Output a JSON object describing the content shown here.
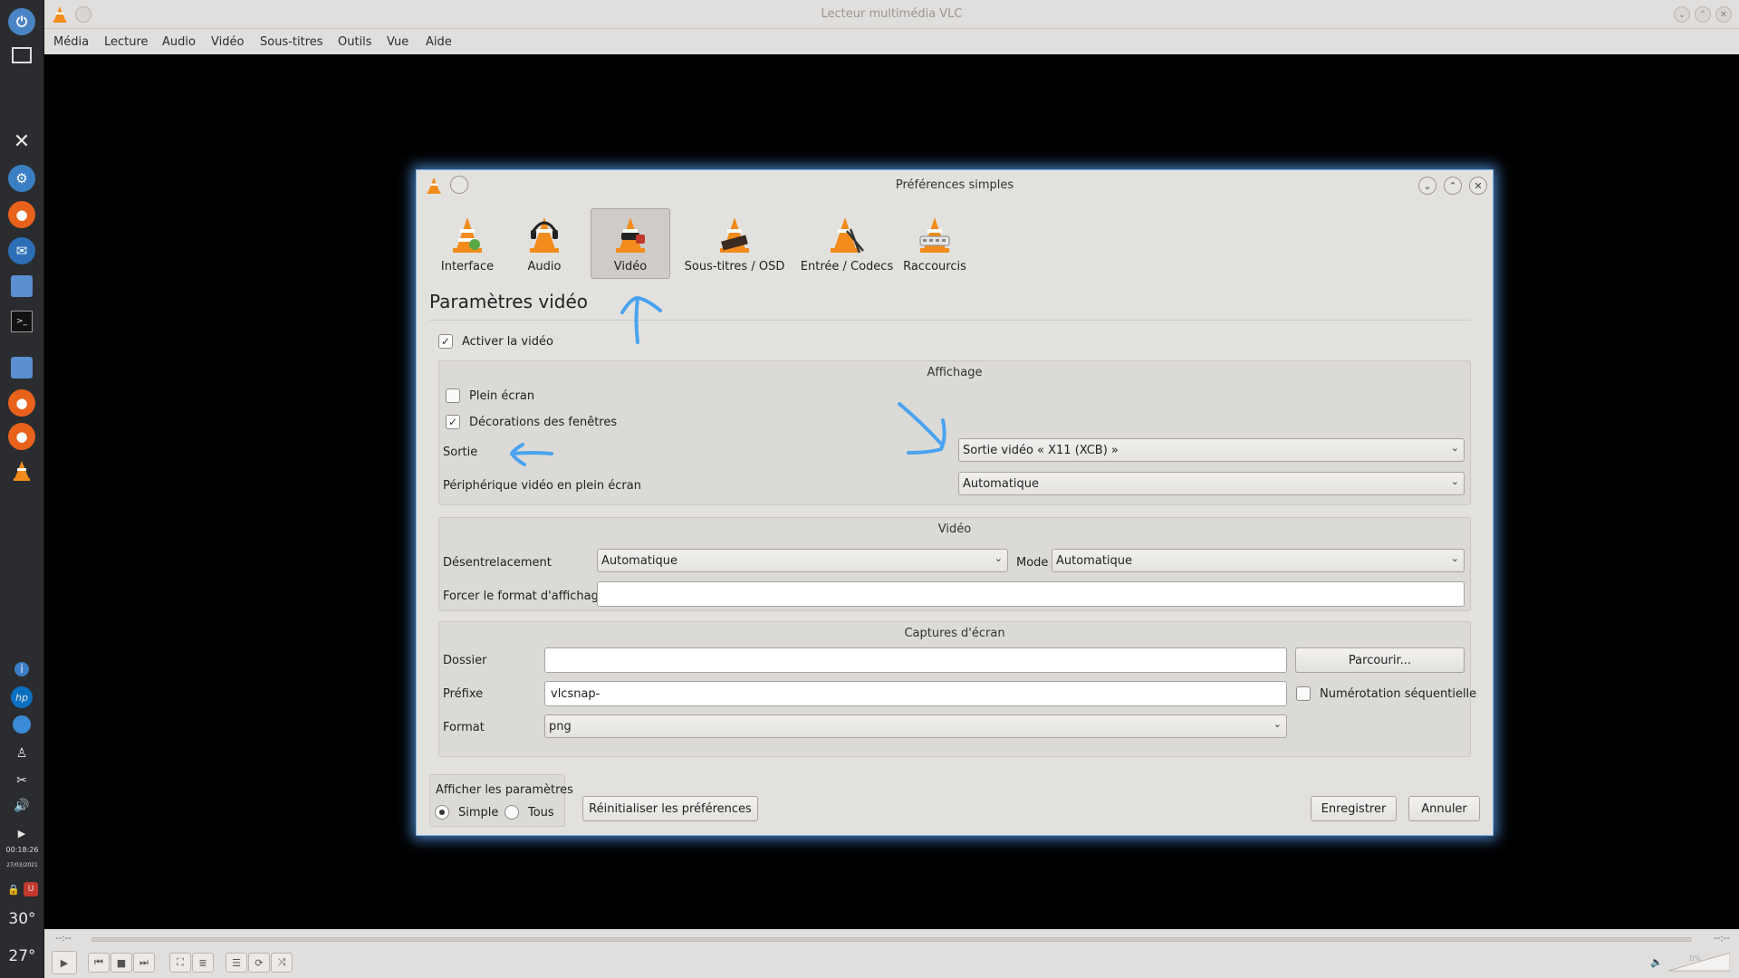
{
  "taskbar": {
    "clock_time": "00:18:26",
    "clock_date": "27/03/2021",
    "temp_1": "30°",
    "temp_2": "27°"
  },
  "vlc": {
    "title": "Lecteur multimédia VLC",
    "menu": [
      "Média",
      "Lecture",
      "Audio",
      "Vidéo",
      "Sous-titres",
      "Outils",
      "Vue",
      "Aide"
    ],
    "time_elapsed": "--:--",
    "time_total": "--:--",
    "volume": "0%"
  },
  "dialog": {
    "title": "Préférences simples",
    "tabs": [
      {
        "label": "Interface",
        "icon": "interface-cone-icon"
      },
      {
        "label": "Audio",
        "icon": "audio-cone-icon"
      },
      {
        "label": "Vidéo",
        "icon": "video-cone-icon"
      },
      {
        "label": "Sous-titres / OSD",
        "icon": "subtitles-cone-icon"
      },
      {
        "label": "Entrée / Codecs",
        "icon": "codecs-cone-icon"
      },
      {
        "label": "Raccourcis",
        "icon": "hotkeys-cone-icon"
      }
    ],
    "active_tab": "Vidéo",
    "section_title": "Paramètres vidéo",
    "enable_video": {
      "label": "Activer la vidéo",
      "checked": true
    },
    "display": {
      "title": "Affichage",
      "fullscreen": {
        "label": "Plein écran",
        "checked": false
      },
      "decorations": {
        "label": "Décorations des fenêtres",
        "checked": true
      },
      "output_label": "Sortie",
      "output_value": "Sortie vidéo « X11 (XCB) »",
      "fs_device_label": "Périphérique vidéo en plein écran",
      "fs_device_value": "Automatique"
    },
    "video": {
      "title": "Vidéo",
      "deinterlace_label": "Désentrelacement",
      "deinterlace_value": "Automatique",
      "mode_label": "Mode",
      "mode_value": "Automatique",
      "aspect_label": "Forcer le format d'affichage",
      "aspect_value": ""
    },
    "snapshots": {
      "title": "Captures d'écran",
      "folder_label": "Dossier",
      "folder_value": "",
      "browse_label": "Parcourir...",
      "prefix_label": "Préfixe",
      "prefix_value": "vlcsnap-",
      "sequential_label": "Numérotation séquentielle",
      "sequential_checked": false,
      "format_label": "Format",
      "format_value": "png"
    },
    "show_settings": {
      "title": "Afficher les paramètres",
      "simple_label": "Simple",
      "all_label": "Tous",
      "selected": "Simple"
    },
    "reset_label": "Réinitialiser les préférences",
    "save_label": "Enregistrer",
    "cancel_label": "Annuler"
  },
  "colors": {
    "annotation_arrow": "#4aa3f0",
    "dialog_glow": "#5aa0f0"
  }
}
